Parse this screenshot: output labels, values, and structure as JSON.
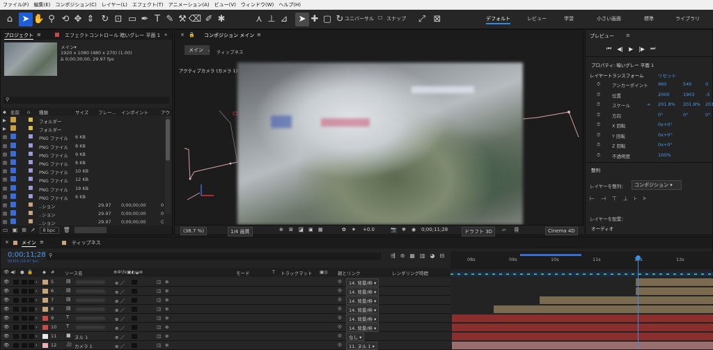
{
  "menubar": [
    "ファイル(F)",
    "編集(E)",
    "コンポジション(C)",
    "レイヤー(L)",
    "エフェクト(T)",
    "アニメーション(A)",
    "ビュー(V)",
    "ウィンドウ(W)",
    "ヘルプ(H)"
  ],
  "toolbar": {
    "universal": "ユニバーサル",
    "snap": "スナップ",
    "workspaces": [
      "デフォルト",
      "レビュー",
      "学習",
      "小さい画面",
      "標準",
      "ライブラリ"
    ]
  },
  "project": {
    "tab_label": "プロジェクト",
    "effects_tab": "エフェクトコントロール 暗いグレー 平面 1",
    "comp_name": "メイン▾",
    "comp_info1": "1920 x 1080 (480 x 270) (1.00)",
    "comp_info2": "Δ 0;00;30;00, 29.97 fps",
    "search_icon": "magnifier",
    "columns": [
      "名前",
      "種類",
      "サイズ",
      "フレー...",
      "インポイント",
      "アウ"
    ],
    "rows": [
      {
        "type": "フォルダー",
        "size": "",
        "fps": "",
        "in": "",
        "out": "",
        "color": "#d8c040",
        "icon": "folder-icon"
      },
      {
        "type": "フォルダー",
        "size": "",
        "fps": "",
        "in": "",
        "out": "",
        "color": "#d8c040",
        "icon": "folder-icon"
      },
      {
        "type": "PNG ファイル",
        "size": "6 KB",
        "fps": "",
        "in": "",
        "out": "",
        "color": "#9a9ad8",
        "icon": "png-icon"
      },
      {
        "type": "PNG ファイル",
        "size": "8 KB",
        "fps": "",
        "in": "",
        "out": "",
        "color": "#9a9ad8",
        "icon": "png-icon"
      },
      {
        "type": "PNG ファイル",
        "size": "9 KB",
        "fps": "",
        "in": "",
        "out": "",
        "color": "#9a9ad8",
        "icon": "png-icon"
      },
      {
        "type": "PNG ファイル",
        "size": "8 KB",
        "fps": "",
        "in": "",
        "out": "",
        "color": "#9a9ad8",
        "icon": "png-icon"
      },
      {
        "type": "PNG ファイル",
        "size": "10 KB",
        "fps": "",
        "in": "",
        "out": "",
        "color": "#9a9ad8",
        "icon": "png-icon"
      },
      {
        "type": "PNG ファイル",
        "size": "12 KB",
        "fps": "",
        "in": "",
        "out": "",
        "color": "#9a9ad8",
        "icon": "png-icon"
      },
      {
        "type": "PNG ファイル",
        "size": "19 KB",
        "fps": "",
        "in": "",
        "out": "",
        "color": "#9a9ad8",
        "icon": "png-icon"
      },
      {
        "type": "PNG ファイル",
        "size": "6 KB",
        "fps": "",
        "in": "",
        "out": "",
        "color": "#9a9ad8",
        "icon": "png-icon"
      },
      {
        "type": "..ション",
        "size": "",
        "fps": "29.97",
        "in": "0;00;00;00",
        "out": "0",
        "color": "#c9a37a",
        "icon": "comp-icon"
      },
      {
        "type": "..ション",
        "size": "",
        "fps": "29.97",
        "in": "0;00;00;00",
        "out": "0",
        "color": "#c9a37a",
        "icon": "comp-icon"
      },
      {
        "type": "..ション",
        "size": "",
        "fps": "29.97",
        "in": "0;00;00;00",
        "out": "C",
        "color": "#c9a37a",
        "icon": "comp-icon"
      }
    ],
    "bpc": "8 bpc"
  },
  "comp": {
    "tab_label": "コンポジション メイン",
    "breadcrumb": "メイン",
    "breadcrumb2": "ティップネス",
    "camera_label": "アクティブカメラ (カメラ 1)",
    "zoom": "(38.7 %)",
    "resolution": "1/4 画質",
    "exposure": "+0.0",
    "timecode": "0;00;11;28",
    "draft": "ドラフト 3D",
    "renderer": "Cinema 4D"
  },
  "preview": {
    "title": "プレビュー"
  },
  "properties": {
    "title": "プロパティ: 暗いグレー 平面 1",
    "section": "レイヤートランスフォーム",
    "reset": "リセット",
    "items": [
      {
        "label": "アンカーポイント",
        "v1": "960",
        "v2": "540",
        "v3": "0"
      },
      {
        "label": "位置",
        "v1": "2000",
        "v2": "1903",
        "v3": "-5"
      },
      {
        "label": "スケール",
        "v1": "201.8%",
        "v2": "201.8%",
        "v3": "201"
      },
      {
        "label": "方向",
        "v1": "0°",
        "v2": "0°",
        "v3": "0°"
      },
      {
        "label": "X 回転",
        "v1": "0x+0°",
        "v2": "",
        "v3": ""
      },
      {
        "label": "Y 回転",
        "v1": "0x+0°",
        "v2": "",
        "v3": ""
      },
      {
        "label": "Z 回転",
        "v1": "0x+0°",
        "v2": "",
        "v3": ""
      },
      {
        "label": "不透明度",
        "v1": "100%",
        "v2": "",
        "v3": ""
      }
    ],
    "align_title": "整列",
    "align_to_label": "レイヤーを整列：",
    "align_to_value": "コンポジション",
    "distribute_label": "レイヤーを配置：",
    "audio_title": "オーディオ"
  },
  "timeline": {
    "tab1": "メイン",
    "tab2": "ティップネス",
    "timecode": "0;00;11;28",
    "timecode_sub": "00358 (29.97 fps)",
    "col_source": "ソース名",
    "col_mode": "モード",
    "col_t": "T",
    "col_matte": "トラックマット",
    "col_parent": "親とリンク",
    "col_render": "レンダリング時間",
    "ruler": [
      "08s",
      "09s",
      "10s",
      "11s",
      "12s",
      "13s"
    ],
    "playhead_sec": 11.95,
    "layers": [
      {
        "num": "5",
        "color": "#c9a37a",
        "icon": "image-icon",
        "parent": "14. 背景/枠",
        "bar_start_sec": 11.9,
        "bar_color": "#7a6a50"
      },
      {
        "num": "6",
        "color": "#c9a37a",
        "icon": "image-icon",
        "parent": "14. 背景/枠",
        "bar_start_sec": 11.9,
        "bar_color": "#7a6a50"
      },
      {
        "num": "7",
        "color": "#c9a37a",
        "icon": "image-icon",
        "parent": "14. 背景/枠",
        "bar_start_sec": 9.6,
        "bar_color": "#7a6a50"
      },
      {
        "num": "8",
        "color": "#c9a37a",
        "icon": "image-icon",
        "parent": "14. 背景/枠",
        "bar_start_sec": 8.5,
        "bar_color": "#7a6a50"
      },
      {
        "num": "9",
        "color": "#c84a4a",
        "icon": "text-icon",
        "parent": "14. 背景/枠",
        "bar_start_sec": 7.5,
        "bar_color": "#8a2e2e"
      },
      {
        "num": "10",
        "color": "#c84a4a",
        "icon": "text-icon",
        "parent": "14. 背景/枠",
        "bar_start_sec": 7.5,
        "bar_color": "#8a2e2e"
      },
      {
        "num": "11",
        "color": "#e8e8e8",
        "icon": "null-icon",
        "name": "ヌル 1",
        "parent": "なし",
        "bar_start_sec": 7.5,
        "bar_color": "#8a2e2e"
      },
      {
        "num": "12",
        "color": "#e8b0b0",
        "icon": "camera-icon",
        "name": "カメラ 1",
        "parent": "11. ヌル 1",
        "bar_start_sec": 7.5,
        "bar_color": "#9a6e6e"
      }
    ]
  }
}
